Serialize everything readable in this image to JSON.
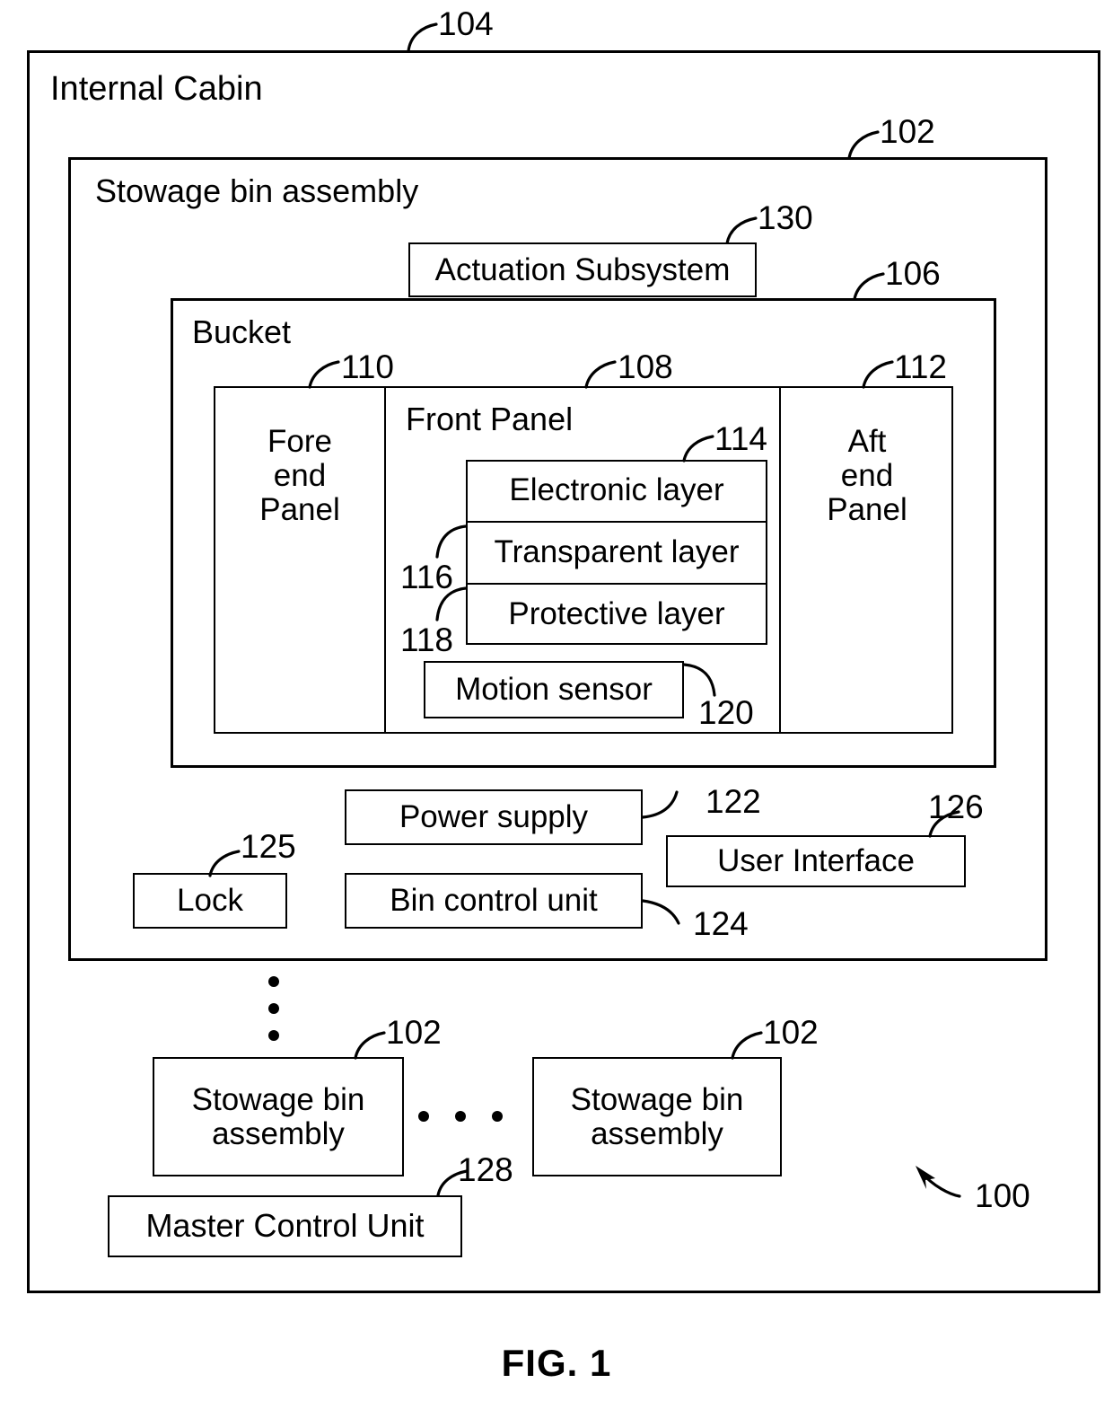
{
  "figure": {
    "caption": "FIG. 1",
    "system_ref": "100"
  },
  "internal_cabin": {
    "label": "Internal Cabin",
    "ref": "104"
  },
  "stowage_bin_assembly": {
    "label": "Stowage bin assembly",
    "ref": "102"
  },
  "actuation_subsystem": {
    "label": "Actuation Subsystem",
    "ref": "130"
  },
  "bucket": {
    "label": "Bucket",
    "ref": "106"
  },
  "panels": {
    "fore_end_panel": {
      "label": "Fore\nend\nPanel",
      "line1": "Fore",
      "line2": "end",
      "line3": "Panel",
      "ref": "110"
    },
    "front_panel": {
      "label": "Front Panel",
      "ref": "108"
    },
    "aft_end_panel": {
      "label": "Aft\nend\nPanel",
      "line1": "Aft",
      "line2": "end",
      "line3": "Panel",
      "ref": "112"
    }
  },
  "layer_stack": {
    "ref": "114",
    "layers": [
      {
        "label": "Electronic layer",
        "ref": "114"
      },
      {
        "label": "Transparent layer",
        "ref": "116"
      },
      {
        "label": "Protective layer",
        "ref": "118"
      }
    ]
  },
  "motion_sensor": {
    "label": "Motion sensor",
    "ref": "120"
  },
  "power_supply": {
    "label": "Power supply",
    "ref": "122"
  },
  "bin_control_unit": {
    "label": "Bin control unit",
    "ref": "124"
  },
  "lock": {
    "label": "Lock",
    "ref": "125"
  },
  "user_interface": {
    "label": "User Interface",
    "ref": "126"
  },
  "master_control_unit": {
    "label": "Master Control Unit",
    "ref": "128"
  },
  "additional_bins": [
    {
      "line1": "Stowage bin",
      "line2": "assembly",
      "ref": "102"
    },
    {
      "line1": "Stowage bin",
      "line2": "assembly",
      "ref": "102"
    }
  ],
  "ellipsis": {
    "vertical": "three vertical dots",
    "horizontal": "three horizontal dots"
  },
  "colors": {
    "stroke": "#000000",
    "background": "#ffffff"
  }
}
